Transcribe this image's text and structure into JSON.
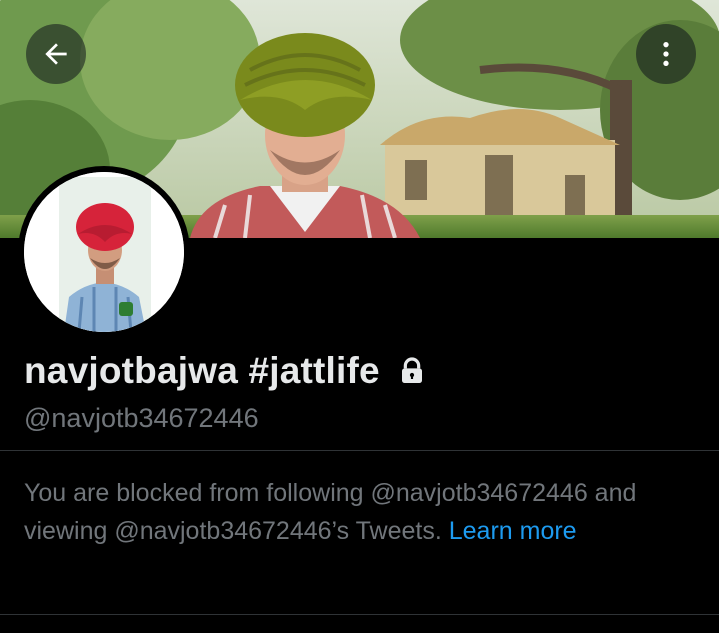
{
  "header": {
    "back_icon": "arrow-left-icon",
    "more_icon": "more-vertical-icon"
  },
  "profile": {
    "display_name": "navjotbajwa #jattlife",
    "lock_icon": "lock-icon",
    "handle": "@navjotb34672446"
  },
  "blocked_notice": {
    "message": "You are blocked from following @navjotb34672446 and viewing @navjotb34672446’s Tweets.",
    "link_label": "Learn more"
  },
  "colors": {
    "background": "#000000",
    "primary_text": "#e7e9ea",
    "secondary_text": "#71767b",
    "link": "#1d9bf0",
    "divider": "#2f3336"
  }
}
